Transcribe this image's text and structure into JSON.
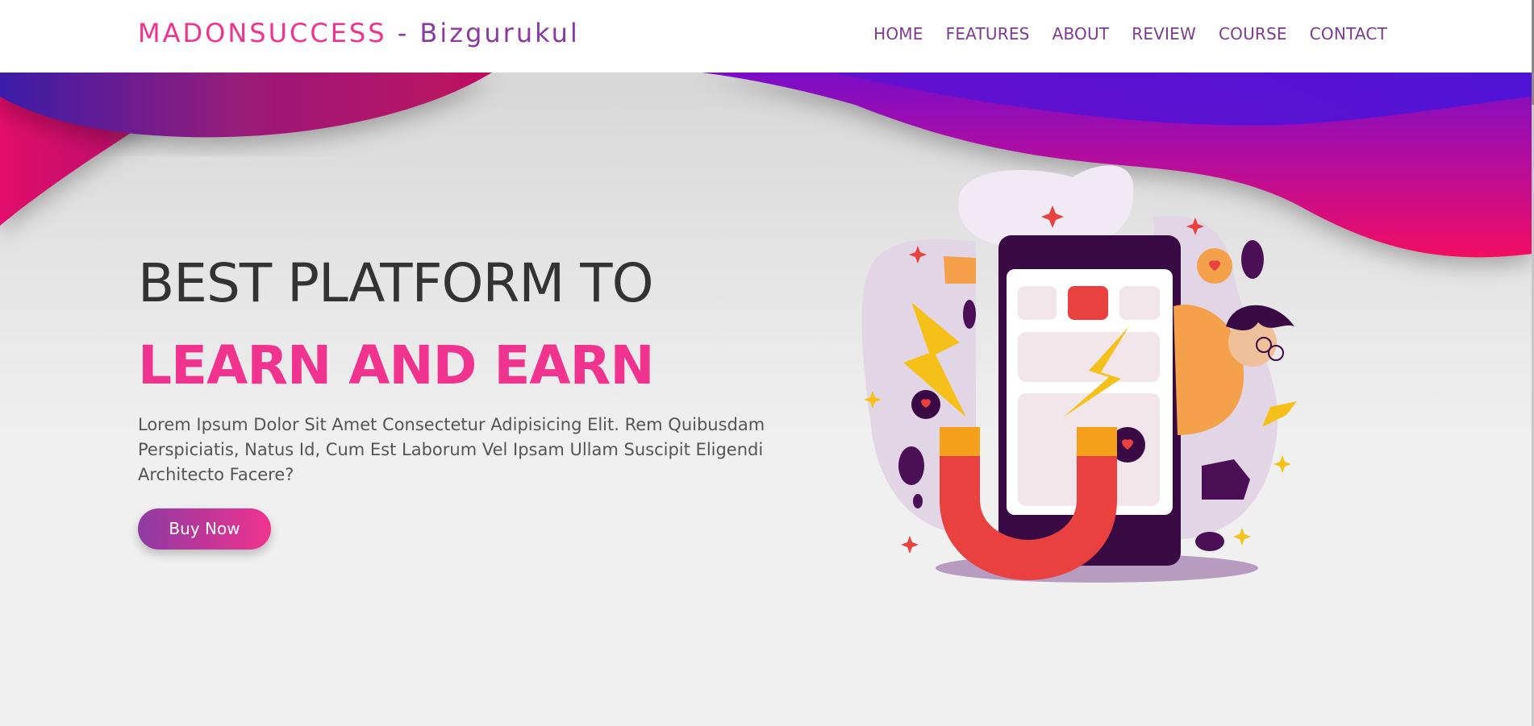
{
  "header": {
    "logo_brand": "MADONSUCCESS",
    "logo_rest": " - Bizgurukul",
    "nav": [
      {
        "label": "HOME"
      },
      {
        "label": "FEATURES"
      },
      {
        "label": "ABOUT"
      },
      {
        "label": "REVIEW"
      },
      {
        "label": "COURSE"
      },
      {
        "label": "CONTACT"
      }
    ]
  },
  "hero": {
    "line1": "BEST PLATFORM TO",
    "line2": "LEARN AND EARN",
    "description": "Lorem Ipsum Dolor Sit Amet Consectetur Adipisicing Elit. Rem Quibusdam Perspiciatis, Natus Id, Cum Est Laborum Vel Ipsam Ullam Suscipit Eligendi Architecto Facere?",
    "button_label": "Buy Now"
  },
  "colors": {
    "brand_pink": "#f0338e",
    "brand_purple": "#8a3aa0",
    "wave_violet": "#5a12d8",
    "wave_magenta": "#e2086c"
  },
  "icons": {
    "illustration": "magnet-phone-illustration"
  }
}
